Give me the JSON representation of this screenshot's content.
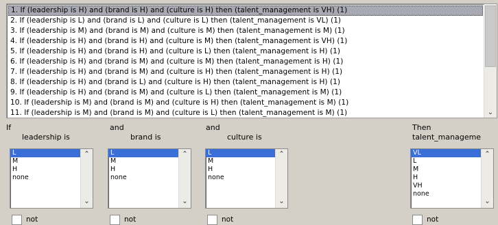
{
  "rules": [
    "1. If (leadership is H) and (brand is H) and (culture is H) then (talent_management is VH) (1)",
    "2. If (leadership is L) and (brand is L) and (culture is L) then (talent_management is VL) (1)",
    "3. If (leadership is M) and (brand is M) and (culture is M) then (talent_management is M) (1)",
    "4. If (leadership is H) and (brand is H) and (culture is M) then (talent_management is VH) (1)",
    "5. If (leadership is H) and (brand is H) and (culture is L) then (talent_management is H) (1)",
    "6. If (leadership is H) and (brand is M) and (culture is M) then (talent_management is H) (1)",
    "7. If (leadership is H) and (brand is M) and (culture is H) then (talent_management is H) (1)",
    "8. If (leadership is H) and (brand is L) and (culture is H) then (talent_management is H) (1)",
    "9. If (leadership is H) and (brand is M) and (culture is L) then (talent_management is M) (1)",
    "10. If (leadership is M) and (brand is M) and (culture is H) then (talent_management is M) (1)",
    "11. If (leadership is M) and (brand is M) and (culture is L) then (talent_management is M) (1)"
  ],
  "columns": {
    "leadership": {
      "prefix": "If",
      "label": "leadership is",
      "options": [
        "L",
        "M",
        "H",
        "none"
      ],
      "selected": "L",
      "not_label": "not"
    },
    "brand": {
      "prefix": "and",
      "label": "brand is",
      "options": [
        "L",
        "M",
        "H",
        "none"
      ],
      "selected": "L",
      "not_label": "not"
    },
    "culture": {
      "prefix": "and",
      "label": "culture is",
      "options": [
        "L",
        "M",
        "H",
        "none"
      ],
      "selected": "L",
      "not_label": "not"
    },
    "talent": {
      "prefix": "Then",
      "label": "talent_manageme",
      "options": [
        "VL",
        "L",
        "M",
        "H",
        "VH",
        "none"
      ],
      "selected": "VL",
      "not_label": "not"
    }
  },
  "colors": {
    "selection": "#3a6fd8",
    "rule_highlight": "#a9a9b4",
    "panel": "#d4d0c8"
  },
  "icons": {
    "scroll_up": "chevron-up-icon",
    "scroll_down": "chevron-down-icon"
  }
}
